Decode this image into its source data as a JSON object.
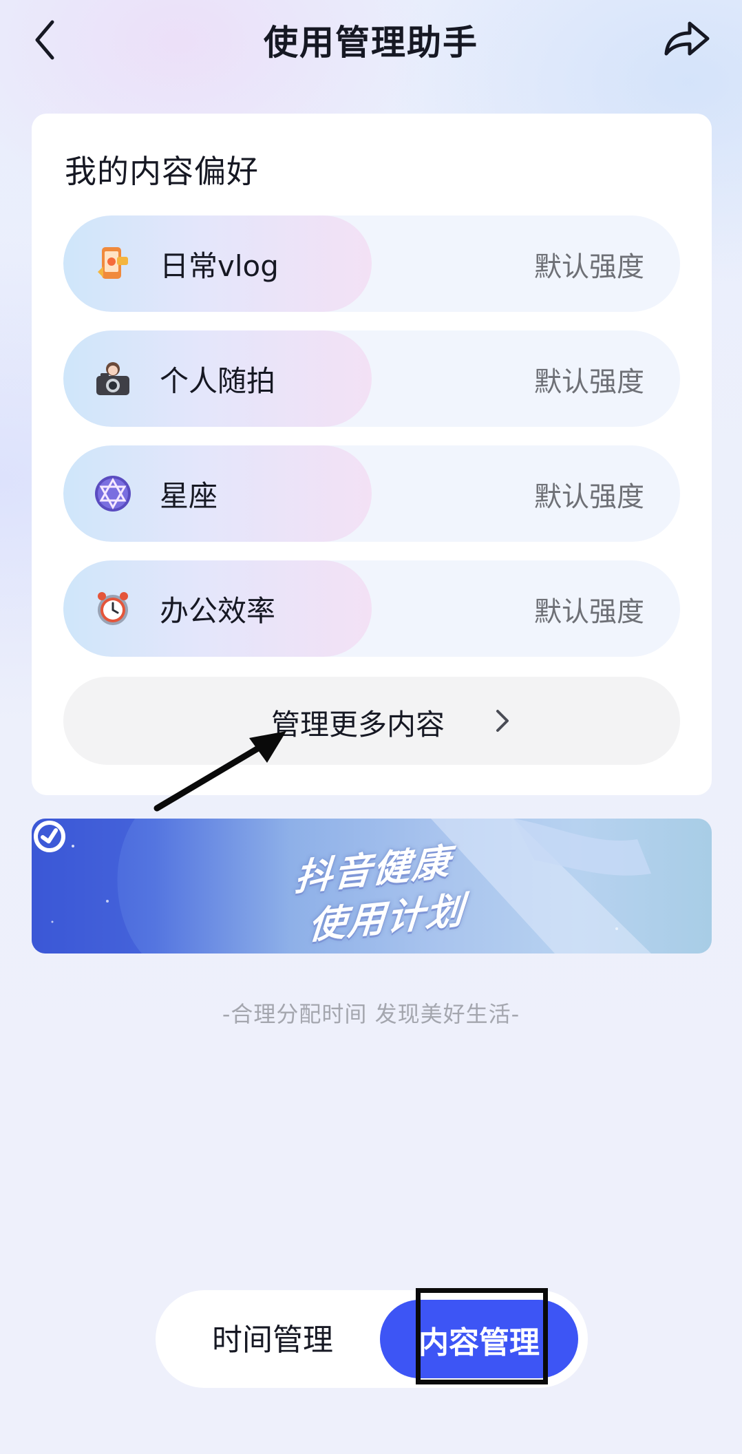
{
  "header": {
    "title": "使用管理助手",
    "back_icon": "chevron-left-icon",
    "share_icon": "share-arrow-icon"
  },
  "preferences": {
    "title": "我的内容偏好",
    "items": [
      {
        "name": "日常vlog",
        "level": "默认强度",
        "icon": "phone-vlog-icon"
      },
      {
        "name": "个人随拍",
        "level": "默认强度",
        "icon": "camera-icon"
      },
      {
        "name": "星座",
        "level": "默认强度",
        "icon": "star-of-david-icon"
      },
      {
        "name": "办公效率",
        "level": "默认强度",
        "icon": "alarm-clock-icon"
      }
    ],
    "more_label": "管理更多内容"
  },
  "banner": {
    "line1": "抖音健康",
    "line2": "使用计划"
  },
  "slogan": "-合理分配时间 发现美好生活-",
  "tabs": {
    "time_label": "时间管理",
    "content_label": "内容管理",
    "active": "content"
  },
  "colors": {
    "accent": "#3d55f5",
    "annotation": "#0a0a0a"
  }
}
